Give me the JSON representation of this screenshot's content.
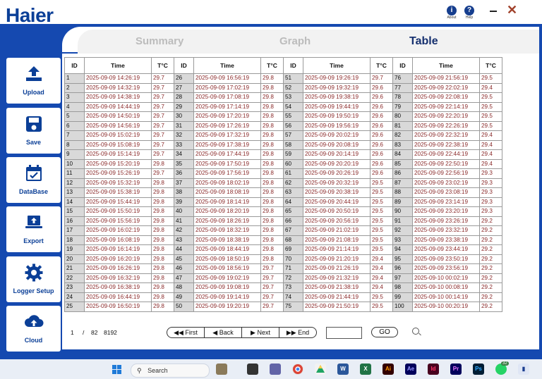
{
  "brand": {
    "logo": "Haier"
  },
  "top_icons": {
    "about": "About",
    "help": "Help"
  },
  "tabs": [
    {
      "label": "Summary",
      "active": false
    },
    {
      "label": "Graph",
      "active": false
    },
    {
      "label": "Table",
      "active": true
    }
  ],
  "sidebar": {
    "items": [
      {
        "label": "Upload",
        "icon": "upload-icon"
      },
      {
        "label": "Save",
        "icon": "floppy-disk-icon"
      },
      {
        "label": "DataBase",
        "icon": "calendar-check-icon"
      },
      {
        "label": "Export",
        "icon": "laptop-upload-icon"
      },
      {
        "label": "Logger Setup",
        "icon": "gear-icon"
      },
      {
        "label": "Cloud",
        "icon": "cloud-upload-icon"
      }
    ]
  },
  "table": {
    "headers": {
      "id": "ID",
      "time": "Time",
      "temp": "T°C"
    },
    "columns": [
      {
        "rows": [
          [
            "1",
            "2025-09-09 14:26:19",
            "29.7"
          ],
          [
            "2",
            "2025-09-09 14:32:19",
            "29.7"
          ],
          [
            "3",
            "2025-09-09 14:38:19",
            "29.7"
          ],
          [
            "4",
            "2025-09-09 14:44:19",
            "29.7"
          ],
          [
            "5",
            "2025-09-09 14:50:19",
            "29.7"
          ],
          [
            "6",
            "2025-09-09 14:56:19",
            "29.7"
          ],
          [
            "7",
            "2025-09-09 15:02:19",
            "29.7"
          ],
          [
            "8",
            "2025-09-09 15:08:19",
            "29.7"
          ],
          [
            "9",
            "2025-09-09 15:14:19",
            "29.7"
          ],
          [
            "10",
            "2025-09-09 15:20:19",
            "29.8"
          ],
          [
            "11",
            "2025-09-09 15:26:19",
            "29.7"
          ],
          [
            "12",
            "2025-09-09 15:32:19",
            "29.8"
          ],
          [
            "13",
            "2025-09-09 15:38:19",
            "29.8"
          ],
          [
            "14",
            "2025-09-09 15:44:19",
            "29.8"
          ],
          [
            "15",
            "2025-09-09 15:50:19",
            "29.8"
          ],
          [
            "16",
            "2025-09-09 15:56:19",
            "29.8"
          ],
          [
            "17",
            "2025-09-09 16:02:19",
            "29.8"
          ],
          [
            "18",
            "2025-09-09 16:08:19",
            "29.8"
          ],
          [
            "19",
            "2025-09-09 16:14:19",
            "29.8"
          ],
          [
            "20",
            "2025-09-09 16:20:19",
            "29.8"
          ],
          [
            "21",
            "2025-09-09 16:26:19",
            "29.8"
          ],
          [
            "22",
            "2025-09-09 16:32:19",
            "29.8"
          ],
          [
            "23",
            "2025-09-09 16:38:19",
            "29.8"
          ],
          [
            "24",
            "2025-09-09 16:44:19",
            "29.8"
          ],
          [
            "25",
            "2025-09-09 16:50:19",
            "29.8"
          ]
        ]
      },
      {
        "rows": [
          [
            "26",
            "2025-09-09 16:56:19",
            "29.8"
          ],
          [
            "27",
            "2025-09-09 17:02:19",
            "29.8"
          ],
          [
            "28",
            "2025-09-09 17:08:19",
            "29.8"
          ],
          [
            "29",
            "2025-09-09 17:14:19",
            "29.8"
          ],
          [
            "30",
            "2025-09-09 17:20:19",
            "29.8"
          ],
          [
            "31",
            "2025-09-09 17:26:19",
            "29.8"
          ],
          [
            "32",
            "2025-09-09 17:32:19",
            "29.8"
          ],
          [
            "33",
            "2025-09-09 17:38:19",
            "29.8"
          ],
          [
            "34",
            "2025-09-09 17:44:19",
            "29.8"
          ],
          [
            "35",
            "2025-09-09 17:50:19",
            "29.8"
          ],
          [
            "36",
            "2025-09-09 17:56:19",
            "29.8"
          ],
          [
            "37",
            "2025-09-09 18:02:19",
            "29.8"
          ],
          [
            "38",
            "2025-09-09 18:08:19",
            "29.8"
          ],
          [
            "39",
            "2025-09-09 18:14:19",
            "29.8"
          ],
          [
            "40",
            "2025-09-09 18:20:19",
            "29.8"
          ],
          [
            "41",
            "2025-09-09 18:26:19",
            "29.8"
          ],
          [
            "42",
            "2025-09-09 18:32:19",
            "29.8"
          ],
          [
            "43",
            "2025-09-09 18:38:19",
            "29.8"
          ],
          [
            "44",
            "2025-09-09 18:44:19",
            "29.8"
          ],
          [
            "45",
            "2025-09-09 18:50:19",
            "29.8"
          ],
          [
            "46",
            "2025-09-09 18:56:19",
            "29.7"
          ],
          [
            "47",
            "2025-09-09 19:02:19",
            "29.7"
          ],
          [
            "48",
            "2025-09-09 19:08:19",
            "29.7"
          ],
          [
            "49",
            "2025-09-09 19:14:19",
            "29.7"
          ],
          [
            "50",
            "2025-09-09 19:20:19",
            "29.7"
          ]
        ]
      },
      {
        "rows": [
          [
            "51",
            "2025-09-09 19:26:19",
            "29.7"
          ],
          [
            "52",
            "2025-09-09 19:32:19",
            "29.6"
          ],
          [
            "53",
            "2025-09-09 19:38:19",
            "29.6"
          ],
          [
            "54",
            "2025-09-09 19:44:19",
            "29.6"
          ],
          [
            "55",
            "2025-09-09 19:50:19",
            "29.6"
          ],
          [
            "56",
            "2025-09-09 19:56:19",
            "29.6"
          ],
          [
            "57",
            "2025-09-09 20:02:19",
            "29.6"
          ],
          [
            "58",
            "2025-09-09 20:08:19",
            "29.6"
          ],
          [
            "59",
            "2025-09-09 20:14:19",
            "29.6"
          ],
          [
            "60",
            "2025-09-09 20:20:19",
            "29.6"
          ],
          [
            "61",
            "2025-09-09 20:26:19",
            "29.6"
          ],
          [
            "62",
            "2025-09-09 20:32:19",
            "29.5"
          ],
          [
            "63",
            "2025-09-09 20:38:19",
            "29.5"
          ],
          [
            "64",
            "2025-09-09 20:44:19",
            "29.5"
          ],
          [
            "65",
            "2025-09-09 20:50:19",
            "29.5"
          ],
          [
            "66",
            "2025-09-09 20:56:19",
            "29.5"
          ],
          [
            "67",
            "2025-09-09 21:02:19",
            "29.5"
          ],
          [
            "68",
            "2025-09-09 21:08:19",
            "29.5"
          ],
          [
            "69",
            "2025-09-09 21:14:19",
            "29.5"
          ],
          [
            "70",
            "2025-09-09 21:20:19",
            "29.4"
          ],
          [
            "71",
            "2025-09-09 21:26:19",
            "29.4"
          ],
          [
            "72",
            "2025-09-09 21:32:19",
            "29.4"
          ],
          [
            "73",
            "2025-09-09 21:38:19",
            "29.4"
          ],
          [
            "74",
            "2025-09-09 21:44:19",
            "29.5"
          ],
          [
            "75",
            "2025-09-09 21:50:19",
            "29.5"
          ]
        ]
      },
      {
        "rows": [
          [
            "76",
            "2025-09-09 21:56:19",
            "29.5"
          ],
          [
            "77",
            "2025-09-09 22:02:19",
            "29.4"
          ],
          [
            "78",
            "2025-09-09 22:08:19",
            "29.5"
          ],
          [
            "79",
            "2025-09-09 22:14:19",
            "29.5"
          ],
          [
            "80",
            "2025-09-09 22:20:19",
            "29.5"
          ],
          [
            "81",
            "2025-09-09 22:26:19",
            "29.5"
          ],
          [
            "82",
            "2025-09-09 22:32:19",
            "29.4"
          ],
          [
            "83",
            "2025-09-09 22:38:19",
            "29.4"
          ],
          [
            "84",
            "2025-09-09 22:44:19",
            "29.4"
          ],
          [
            "85",
            "2025-09-09 22:50:19",
            "29.4"
          ],
          [
            "86",
            "2025-09-09 22:56:19",
            "29.3"
          ],
          [
            "87",
            "2025-09-09 23:02:19",
            "29.3"
          ],
          [
            "88",
            "2025-09-09 23:08:19",
            "29.3"
          ],
          [
            "89",
            "2025-09-09 23:14:19",
            "29.3"
          ],
          [
            "90",
            "2025-09-09 23:20:19",
            "29.3"
          ],
          [
            "91",
            "2025-09-09 23:26:19",
            "29.2"
          ],
          [
            "92",
            "2025-09-09 23:32:19",
            "29.2"
          ],
          [
            "93",
            "2025-09-09 23:38:19",
            "29.2"
          ],
          [
            "94",
            "2025-09-09 23:44:19",
            "29.2"
          ],
          [
            "95",
            "2025-09-09 23:50:19",
            "29.2"
          ],
          [
            "96",
            "2025-09-09 23:56:19",
            "29.2"
          ],
          [
            "97",
            "2025-09-10 00:02:19",
            "29.2"
          ],
          [
            "98",
            "2025-09-10 00:08:19",
            "29.2"
          ],
          [
            "99",
            "2025-09-10 00:14:19",
            "29.2"
          ],
          [
            "100",
            "2025-09-10 00:20:19",
            "29.2"
          ]
        ]
      }
    ]
  },
  "pager": {
    "current_page": "1",
    "separator": "/",
    "total_pages": "82",
    "total_records": "8192",
    "first_label": "First",
    "back_label": "Back",
    "next_label": "Next",
    "end_label": "End",
    "go_label": "GO",
    "page_input_value": ""
  },
  "taskbar": {
    "search_placeholder": "Search",
    "chat_badge": "32",
    "apps": [
      "Ai",
      "Ae",
      "Id",
      "Pr",
      "Ps"
    ]
  },
  "colors": {
    "brand_blue": "#1549b0",
    "logo_blue": "#0b3f97",
    "cell_text": "#8b2b2b",
    "id_cell_bg": "#d9d9d9",
    "active_tab": "#16306f",
    "inactive_tab": "#bcbcbc"
  }
}
